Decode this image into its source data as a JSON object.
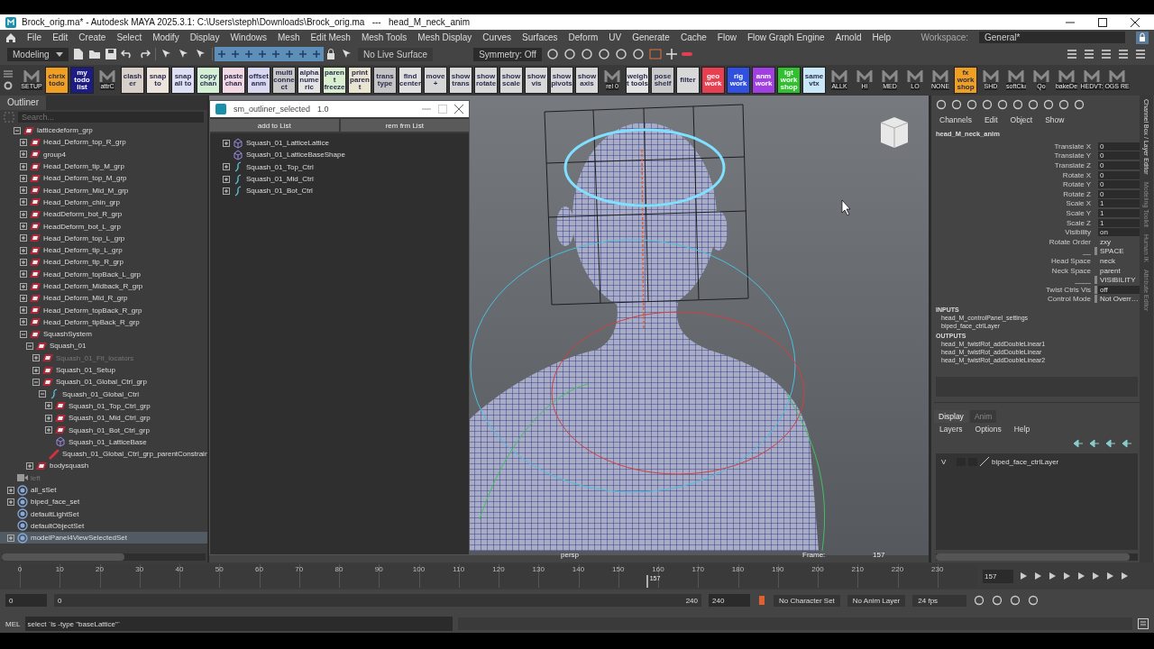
{
  "window": {
    "title": "Brock_orig.ma* - Autodesk MAYA 2025.3.1: C:\\Users\\steph\\Downloads\\Brock_orig.ma   ---   head_M_neck_anim"
  },
  "menu_bar": [
    "File",
    "Edit",
    "Create",
    "Select",
    "Modify",
    "Display",
    "Windows",
    "Mesh",
    "Edit Mesh",
    "Mesh Tools",
    "Mesh Display",
    "Curves",
    "Surfaces",
    "Deform",
    "UV",
    "Generate",
    "Cache",
    "Flow",
    "Flow Graph Engine",
    "Arnold",
    "Help"
  ],
  "workspace": {
    "label": "Workspace:",
    "value": "General*"
  },
  "status_line": {
    "menu_set": "Modeling",
    "live_surface": "No Live Surface",
    "symmetry": "Symmetry: Off"
  },
  "shelf": [
    {
      "kind": "tool",
      "label": "SETUP"
    },
    {
      "kind": "tile",
      "label": "chrix todo",
      "color": "#f0a020"
    },
    {
      "kind": "tile",
      "label": "my todo list",
      "color": "#1c1c84"
    },
    {
      "kind": "tool",
      "label": "attrC"
    },
    {
      "kind": "tile",
      "label": "clasher",
      "color": "#d8d0c8"
    },
    {
      "kind": "tile",
      "label": "snap to",
      "color": "#ece4dc"
    },
    {
      "kind": "tile",
      "label": "snap all to",
      "color": "#dde0f2"
    },
    {
      "kind": "tile",
      "label": "copy chan",
      "color": "#d4f0d4"
    },
    {
      "kind": "tile",
      "label": "paste chan",
      "color": "#f2d8e2"
    },
    {
      "kind": "tile",
      "label": "offset anm",
      "color": "#d8d8f0"
    },
    {
      "kind": "tile",
      "label": "multi connect",
      "color": "#c8c8c8"
    },
    {
      "kind": "tile",
      "label": "alpha numeric",
      "color": "#e4e4e4"
    },
    {
      "kind": "tile",
      "label": "parent freeze",
      "color": "#d8f0d0"
    },
    {
      "kind": "tile",
      "label": "print parent",
      "color": "#e8e4d0"
    },
    {
      "kind": "tile",
      "label": "trans type",
      "color": "#c4c4c4"
    },
    {
      "kind": "tile",
      "label": "find center",
      "color": "#e0e0e0"
    },
    {
      "kind": "tile",
      "label": "move +",
      "color": "#d6d6d6"
    },
    {
      "kind": "tile",
      "label": "show trans",
      "color": "#d8d8d8"
    },
    {
      "kind": "tile",
      "label": "show rotate",
      "color": "#d8d8d8"
    },
    {
      "kind": "tile",
      "label": "show scale",
      "color": "#d8d8d8"
    },
    {
      "kind": "tile",
      "label": "show vis",
      "color": "#d8d8d8"
    },
    {
      "kind": "tile",
      "label": "show pivots",
      "color": "#d8d8d8"
    },
    {
      "kind": "tile",
      "label": "show axis",
      "color": "#d8d8d8"
    },
    {
      "kind": "tool",
      "label": "rel 0"
    },
    {
      "kind": "tile",
      "label": "weight tools",
      "color": "#e2e2e2"
    },
    {
      "kind": "tile",
      "label": "pose shelf",
      "color": "#c8c8c8"
    },
    {
      "kind": "tile",
      "label": "filter",
      "color": "#d8d8d8"
    },
    {
      "kind": "tile",
      "label": "geo work",
      "color": "#e84050"
    },
    {
      "kind": "tile",
      "label": "rig work",
      "color": "#3050e0"
    },
    {
      "kind": "tile",
      "label": "anm work",
      "color": "#a040e0"
    },
    {
      "kind": "tile",
      "label": "lgt work shop",
      "color": "#30c030"
    },
    {
      "kind": "tile",
      "label": "same vtx",
      "color": "#c8e8f8"
    },
    {
      "kind": "tool",
      "label": "ALLK"
    },
    {
      "kind": "tool",
      "label": "HI"
    },
    {
      "kind": "tool",
      "label": "MED"
    },
    {
      "kind": "tool",
      "label": "LO"
    },
    {
      "kind": "tool",
      "label": "NONE"
    },
    {
      "kind": "tile",
      "label": "fx work shop",
      "color": "#f0a020"
    },
    {
      "kind": "tool",
      "label": "SHD"
    },
    {
      "kind": "tool",
      "label": "softClu"
    },
    {
      "kind": "tool",
      "label": "Qo"
    },
    {
      "kind": "tool",
      "label": "bakeDe"
    },
    {
      "kind": "tool",
      "label": "HEDVT:"
    },
    {
      "kind": "tool",
      "label": "OGS RE"
    }
  ],
  "outliner": {
    "tab": "Outliner",
    "search_placeholder": "Search...",
    "scrolled_branch": [
      {
        "label": "latticedeform_grp",
        "kind": "transform",
        "expanded": true,
        "selected": false,
        "dimmed": false,
        "children": [
          {
            "label": "Head_Deform_top_R_grp",
            "kind": "transform",
            "expanded": false,
            "selected": false,
            "dimmed": false
          },
          {
            "label": "group4",
            "kind": "transform",
            "expanded": false,
            "selected": false,
            "dimmed": false
          },
          {
            "label": "Head_Deform_tip_M_grp",
            "kind": "transform",
            "expanded": false,
            "selected": false,
            "dimmed": false
          },
          {
            "label": "Head_Deform_top_M_grp",
            "kind": "transform",
            "expanded": false,
            "selected": false,
            "dimmed": false
          },
          {
            "label": "Head_Deform_Mid_M_grp",
            "kind": "transform",
            "expanded": false,
            "selected": false,
            "dimmed": false
          },
          {
            "label": "Head_Deform_chin_grp",
            "kind": "transform",
            "expanded": false,
            "selected": false,
            "dimmed": false
          },
          {
            "label": "HeadDeform_bot_R_grp",
            "kind": "transform",
            "expanded": false,
            "selected": false,
            "dimmed": false
          },
          {
            "label": "HeadDeform_bot_L_grp",
            "kind": "transform",
            "expanded": false,
            "selected": false,
            "dimmed": false
          },
          {
            "label": "Head_Deform_top_L_grp",
            "kind": "transform",
            "expanded": false,
            "selected": false,
            "dimmed": false
          },
          {
            "label": "Head_Deform_tip_L_grp",
            "kind": "transform",
            "expanded": false,
            "selected": false,
            "dimmed": false
          },
          {
            "label": "Head_Deform_tip_R_grp",
            "kind": "transform",
            "expanded": false,
            "selected": false,
            "dimmed": false
          },
          {
            "label": "Head_Deform_topBack_L_grp",
            "kind": "transform",
            "expanded": false,
            "selected": false,
            "dimmed": false
          },
          {
            "label": "Head_Deform_Midback_R_grp",
            "kind": "transform",
            "expanded": false,
            "selected": false,
            "dimmed": false
          },
          {
            "label": "Head_Deform_Mid_R_grp",
            "kind": "transform",
            "expanded": false,
            "selected": false,
            "dimmed": false
          },
          {
            "label": "Head_Deform_topBack_R_grp",
            "kind": "transform",
            "expanded": false,
            "selected": false,
            "dimmed": false
          },
          {
            "label": "Head_Deform_tipBack_R_grp",
            "kind": "transform",
            "expanded": false,
            "selected": false,
            "dimmed": false
          },
          {
            "label": "SquashSystem",
            "kind": "transform",
            "expanded": true,
            "selected": false,
            "dimmed": false,
            "children": [
              {
                "label": "Squash_01",
                "kind": "transform",
                "expanded": true,
                "selected": false,
                "dimmed": false,
                "children": [
                  {
                    "label": "Squash_01_Fit_locators",
                    "kind": "transform",
                    "expanded": false,
                    "selected": false,
                    "dimmed": true
                  },
                  {
                    "label": "Squash_01_Setup",
                    "kind": "transform",
                    "expanded": false,
                    "selected": false,
                    "dimmed": false
                  },
                  {
                    "label": "Squash_01_Global_Ctrl_grp",
                    "kind": "transform",
                    "expanded": true,
                    "selected": false,
                    "dimmed": false,
                    "children": [
                      {
                        "label": "Squash_01_Global_Ctrl",
                        "kind": "curve",
                        "expanded": true,
                        "selected": false,
                        "dimmed": false,
                        "children": [
                          {
                            "label": "Squash_01_Top_Ctrl_grp",
                            "kind": "transform",
                            "expanded": false,
                            "selected": false,
                            "dimmed": false
                          },
                          {
                            "label": "Squash_01_Mid_Ctrl_grp",
                            "kind": "transform",
                            "expanded": false,
                            "selected": false,
                            "dimmed": false
                          },
                          {
                            "label": "Squash_01_Bot_Ctrl_grp",
                            "kind": "transform",
                            "expanded": false,
                            "selected": false,
                            "dimmed": false
                          },
                          {
                            "label": "Squash_01_LatticeBase",
                            "kind": "lattice",
                            "selected": false,
                            "dimmed": false
                          }
                        ]
                      },
                      {
                        "label": "Squash_01_Global_Ctrl_grp_parentConstrain",
                        "kind": "constraint",
                        "selected": false,
                        "dimmed": false
                      }
                    ]
                  }
                ]
              },
              {
                "label": "bodysquash",
                "kind": "transform",
                "expanded": false,
                "selected": false,
                "dimmed": false
              }
            ]
          }
        ]
      }
    ],
    "items": [
      {
        "label": "left",
        "kind": "camera",
        "selected": false,
        "dimmed": true
      },
      {
        "label": "all_sSet",
        "kind": "set",
        "expanded": false,
        "selected": false,
        "dimmed": false
      },
      {
        "label": "biped_face_set",
        "kind": "set",
        "expanded": false,
        "selected": false,
        "dimmed": false
      },
      {
        "label": "defaultLightSet",
        "kind": "set",
        "selected": false,
        "dimmed": false
      },
      {
        "label": "defaultObjectSet",
        "kind": "set",
        "selected": false,
        "dimmed": false
      },
      {
        "label": "modelPanel4ViewSelectedSet",
        "kind": "set",
        "expanded": false,
        "selected": true,
        "dimmed": false
      }
    ]
  },
  "floating_window": {
    "title": "sm_outliner_selected",
    "version": "1.0",
    "buttons": [
      "add to List",
      "rem frm List"
    ],
    "items": [
      {
        "label": "Squash_01_LatticeLattice",
        "kind": "lattice",
        "expanded": false
      },
      {
        "label": "Squash_01_LatticeBaseShape",
        "kind": "lattice"
      },
      {
        "label": "Squash_01_Top_Ctrl",
        "kind": "curve",
        "expanded": false
      },
      {
        "label": "Squash_01_Mid_Ctrl",
        "kind": "curve",
        "expanded": false
      },
      {
        "label": "Squash_01_Bot_Ctrl",
        "kind": "curve",
        "expanded": false
      }
    ]
  },
  "viewport": {
    "camera": "persp",
    "frame_label": "Frame:",
    "frame": "157"
  },
  "channel_box": {
    "menus": [
      "Channels",
      "Edit",
      "Object",
      "Show"
    ],
    "node": "head_M_neck_anim",
    "attributes": [
      {
        "name": "Translate X",
        "value": "0",
        "kind": "field"
      },
      {
        "name": "Translate Y",
        "value": "0",
        "kind": "field"
      },
      {
        "name": "Translate Z",
        "value": "0",
        "kind": "field"
      },
      {
        "name": "Rotate X",
        "value": "0",
        "kind": "field"
      },
      {
        "name": "Rotate Y",
        "value": "0",
        "kind": "field"
      },
      {
        "name": "Rotate Z",
        "value": "0",
        "kind": "field"
      },
      {
        "name": "Scale X",
        "value": "1",
        "kind": "field"
      },
      {
        "name": "Scale Y",
        "value": "1",
        "kind": "field"
      },
      {
        "name": "Scale Z",
        "value": "1",
        "kind": "field"
      },
      {
        "name": "Visibility",
        "value": "on",
        "kind": "field"
      },
      {
        "name": "Rotate Order",
        "value": "zxy",
        "kind": "plain"
      },
      {
        "name": "__",
        "value": "SPACE",
        "kind": "enum"
      },
      {
        "name": "Head Space",
        "value": "neck",
        "kind": "plain"
      },
      {
        "name": "Neck Space",
        "value": "parent",
        "kind": "plain"
      },
      {
        "name": "____",
        "value": "VISIBILITY",
        "kind": "enum"
      },
      {
        "name": "Twist Ctrls Vis",
        "value": "off",
        "kind": "enum-field"
      },
      {
        "name": "Control Mode",
        "value": "Not Overr…",
        "kind": "enum"
      }
    ],
    "inputs_heading": "INPUTS",
    "inputs": [
      "head_M_controlPanel_settings",
      "biped_face_ctrlLayer"
    ],
    "outputs_heading": "OUTPUTS",
    "outputs": [
      "head_M_twistRot_addDoubleLinear1",
      "head_M_twistRot_addDoubleLinear",
      "head_M_twistRot_addDoubleLinear2"
    ]
  },
  "layer_editor": {
    "tabs": [
      {
        "label": "Display",
        "selected": true
      },
      {
        "label": "Anim",
        "selected": false
      }
    ],
    "menus": [
      "Layers",
      "Options",
      "Help"
    ],
    "layers": [
      {
        "visibility": "V",
        "name": "biped_face_ctrlLayer"
      }
    ]
  },
  "side_tabs": [
    {
      "label": "Channel Box / Layer Editor",
      "selected": true
    },
    {
      "label": "Modeling Toolkit",
      "selected": false
    },
    {
      "label": "Human IK",
      "selected": false
    },
    {
      "label": "Attribute Editor",
      "selected": false
    }
  ],
  "timeline": {
    "ticks": [
      "0",
      "10",
      "20",
      "30",
      "40",
      "50",
      "60",
      "70",
      "80",
      "90",
      "100",
      "110",
      "120",
      "130",
      "140",
      "150",
      "160",
      "170",
      "180",
      "190",
      "200",
      "210",
      "220",
      "230"
    ],
    "current_frame": "157",
    "frame_field": "157"
  },
  "range": {
    "start": "0",
    "slider_start": "0",
    "slider_end": "240",
    "end": "240",
    "character_set": "No Character Set",
    "anim_layer": "No Anim Layer",
    "fps": "24 fps"
  },
  "command_line": {
    "language": "MEL",
    "value": "select `ls -type \"baseLattice\"`"
  }
}
